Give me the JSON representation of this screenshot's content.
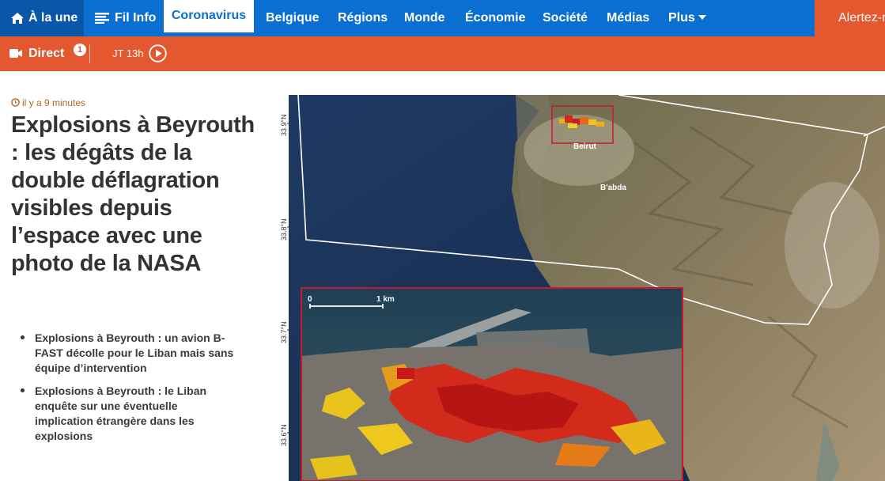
{
  "nav": {
    "home": "À la une",
    "filinfo": "Fil Info",
    "coronavirus": "Coronavirus",
    "belgique": "Belgique",
    "regions": "Régions",
    "monde": "Monde",
    "economie": "Économie",
    "societe": "Société",
    "medias": "Médias",
    "plus": "Plus",
    "alert": "Alertez-nous"
  },
  "subbar": {
    "direct": "Direct",
    "direct_count": "1",
    "jt": "JT 13h"
  },
  "article": {
    "timestamp": "il y a 9 minutes",
    "headline": "Explosions à Beyrouth : les dégâts de la double déflagration visibles depuis l’espace avec une photo de la NASA",
    "related": [
      "Explosions à Beyrouth : un avion B-FAST décolle pour le Liban mais sans équipe d’intervention",
      "Explosions à Beyrouth : le Liban enquête sur une éventuelle implication étrangère dans les explosions"
    ]
  },
  "map": {
    "lat_labels": [
      "33.9°N",
      "33.8°N",
      "33.7°N",
      "33.6°N"
    ],
    "place_beirut": "Beirut",
    "place_babda": "B'abda",
    "scale_zero": "0",
    "scale_km": "1 km"
  },
  "colors": {
    "nav_blue": "#0a6fd1",
    "nav_dark_blue": "#0a56a8",
    "accent_orange": "#e4582f",
    "timestamp": "#b5651d"
  }
}
